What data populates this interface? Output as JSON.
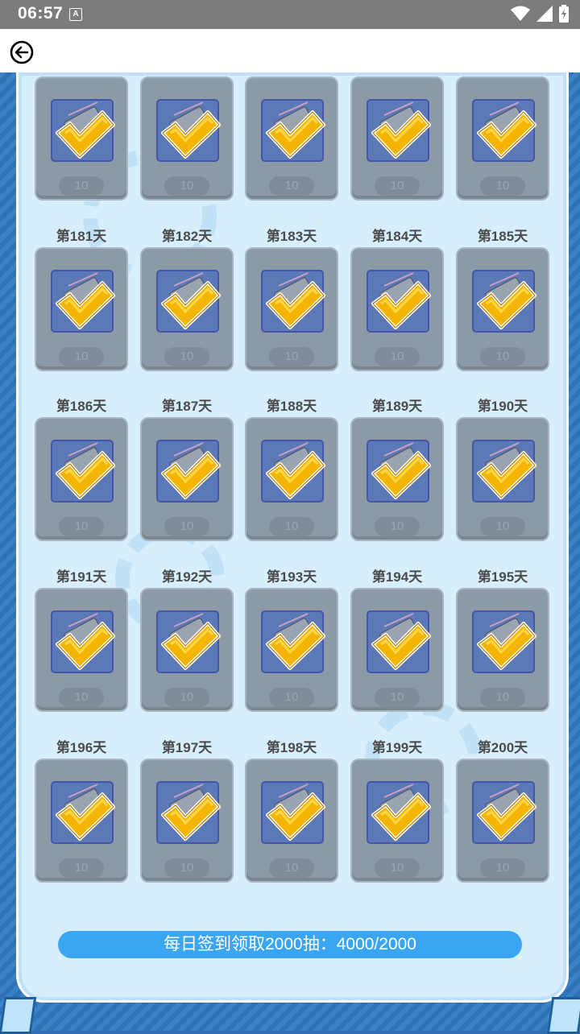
{
  "status_bar": {
    "time": "06:57",
    "notification_icon": "A",
    "icons": [
      "wifi-icon",
      "signal-icon",
      "battery-icon"
    ]
  },
  "app_bar": {
    "back_icon": "arrow-left-circle-icon"
  },
  "reward_amount": "10",
  "rows": [
    {
      "days": [
        null,
        null,
        null,
        null,
        null
      ]
    },
    {
      "days": [
        "第181天",
        "第182天",
        "第183天",
        "第184天",
        "第185天"
      ]
    },
    {
      "days": [
        "第186天",
        "第187天",
        "第188天",
        "第189天",
        "第190天"
      ]
    },
    {
      "days": [
        "第191天",
        "第192天",
        "第193天",
        "第194天",
        "第195天"
      ]
    },
    {
      "days": [
        "第196天",
        "第197天",
        "第198天",
        "第199天",
        "第200天"
      ]
    }
  ],
  "cells": [
    {
      "day": "",
      "amount": "10",
      "claimed": true
    },
    {
      "day": "",
      "amount": "10",
      "claimed": true
    },
    {
      "day": "",
      "amount": "10",
      "claimed": true
    },
    {
      "day": "",
      "amount": "10",
      "claimed": true
    },
    {
      "day": "",
      "amount": "10",
      "claimed": true
    },
    {
      "day": "第181天",
      "amount": "10",
      "claimed": true
    },
    {
      "day": "第182天",
      "amount": "10",
      "claimed": true
    },
    {
      "day": "第183天",
      "amount": "10",
      "claimed": true
    },
    {
      "day": "第184天",
      "amount": "10",
      "claimed": true
    },
    {
      "day": "第185天",
      "amount": "10",
      "claimed": true
    },
    {
      "day": "第186天",
      "amount": "10",
      "claimed": true
    },
    {
      "day": "第187天",
      "amount": "10",
      "claimed": true
    },
    {
      "day": "第188天",
      "amount": "10",
      "claimed": true
    },
    {
      "day": "第189天",
      "amount": "10",
      "claimed": true
    },
    {
      "day": "第190天",
      "amount": "10",
      "claimed": true
    },
    {
      "day": "第191天",
      "amount": "10",
      "claimed": true
    },
    {
      "day": "第192天",
      "amount": "10",
      "claimed": true
    },
    {
      "day": "第193天",
      "amount": "10",
      "claimed": true
    },
    {
      "day": "第194天",
      "amount": "10",
      "claimed": true
    },
    {
      "day": "第195天",
      "amount": "10",
      "claimed": true
    },
    {
      "day": "第196天",
      "amount": "10",
      "claimed": true
    },
    {
      "day": "第197天",
      "amount": "10",
      "claimed": true
    },
    {
      "day": "第198天",
      "amount": "10",
      "claimed": true
    },
    {
      "day": "第199天",
      "amount": "10",
      "claimed": true
    },
    {
      "day": "第200天",
      "amount": "10",
      "claimed": true
    }
  ],
  "progress": {
    "text": "每日签到领取2000抽：4000/2000"
  },
  "colors": {
    "accent": "#3aa6f2",
    "check": "#f5b400",
    "card": "#8b9aa6",
    "icon_bg": "#5b79b6"
  }
}
